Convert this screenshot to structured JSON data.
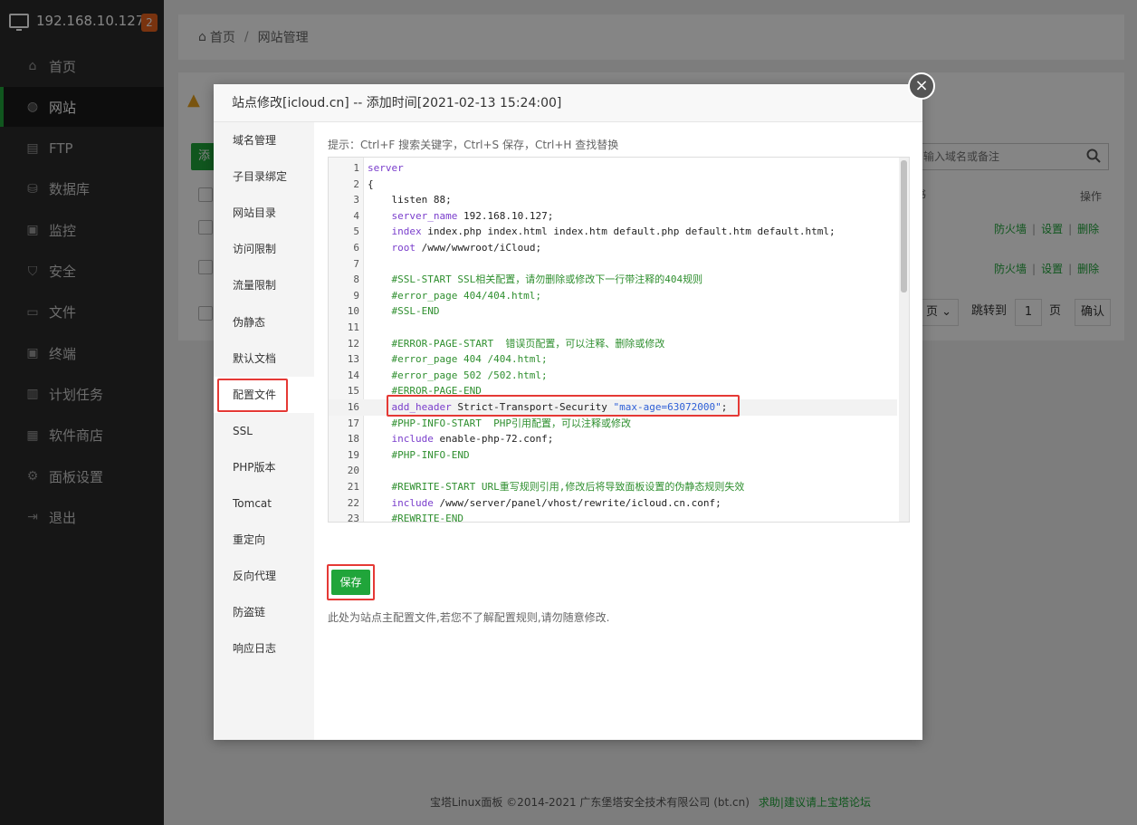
{
  "sidebar": {
    "server_ip": "192.168.10.127",
    "badge": "2",
    "items": [
      {
        "label": "首页",
        "icon": "home-icon"
      },
      {
        "label": "网站",
        "icon": "globe-icon"
      },
      {
        "label": "FTP",
        "icon": "ftp-icon"
      },
      {
        "label": "数据库",
        "icon": "database-icon"
      },
      {
        "label": "监控",
        "icon": "monitor-icon"
      },
      {
        "label": "安全",
        "icon": "shield-icon"
      },
      {
        "label": "文件",
        "icon": "folder-icon"
      },
      {
        "label": "终端",
        "icon": "terminal-icon"
      },
      {
        "label": "计划任务",
        "icon": "clock-icon"
      },
      {
        "label": "软件商店",
        "icon": "grid-icon"
      },
      {
        "label": "面板设置",
        "icon": "gear-icon"
      },
      {
        "label": "退出",
        "icon": "logout-icon"
      }
    ]
  },
  "breadcrumb": {
    "home": "首页",
    "current": "网站管理"
  },
  "background": {
    "add_button": "添",
    "search_placeholder": "输入域名或备注",
    "col_partial": "书",
    "col_ops": "操作",
    "row_ops": {
      "firewall": "防火墙",
      "settings": "设置",
      "delete": "删除"
    },
    "pager": {
      "page_partial": "页",
      "jump_to": "跳转到",
      "page_num": "1",
      "page_unit": "页",
      "confirm": "确认"
    }
  },
  "modal": {
    "title": "站点修改[icloud.cn] -- 添加时间[2021-02-13 15:24:00]",
    "tabs": [
      "域名管理",
      "子目录绑定",
      "网站目录",
      "访问限制",
      "流量限制",
      "伪静态",
      "默认文档",
      "配置文件",
      "SSL",
      "PHP版本",
      "Tomcat",
      "重定向",
      "反向代理",
      "防盗链",
      "响应日志"
    ],
    "active_tab": "配置文件",
    "hint": "提示：Ctrl+F 搜索关键字，Ctrl+S 保存，Ctrl+H 查找替换",
    "save_label": "保存",
    "note": "此处为站点主配置文件,若您不了解配置规则,请勿随意修改.",
    "code_lines": [
      {
        "n": "1",
        "text": "server"
      },
      {
        "n": "2",
        "text": "{"
      },
      {
        "n": "3",
        "text": "    listen 88;"
      },
      {
        "n": "4",
        "text": "    server_name 192.168.10.127;"
      },
      {
        "n": "5",
        "text": "    index index.php index.html index.htm default.php default.htm default.html;"
      },
      {
        "n": "6",
        "text": "    root /www/wwwroot/iCloud;"
      },
      {
        "n": "7",
        "text": ""
      },
      {
        "n": "8",
        "text": "    #SSL-START SSL相关配置，请勿删除或修改下一行带注释的404规则"
      },
      {
        "n": "9",
        "text": "    #error_page 404/404.html;"
      },
      {
        "n": "10",
        "text": "    #SSL-END"
      },
      {
        "n": "11",
        "text": ""
      },
      {
        "n": "12",
        "text": "    #ERROR-PAGE-START  错误页配置，可以注释、删除或修改"
      },
      {
        "n": "13",
        "text": "    #error_page 404 /404.html;"
      },
      {
        "n": "14",
        "text": "    #error_page 502 /502.html;"
      },
      {
        "n": "15",
        "text": "    #ERROR-PAGE-END"
      },
      {
        "n": "16",
        "text": "    add_header Strict-Transport-Security \"max-age=63072000\";"
      },
      {
        "n": "17",
        "text": "    #PHP-INFO-START  PHP引用配置，可以注释或修改"
      },
      {
        "n": "18",
        "text": "    include enable-php-72.conf;"
      },
      {
        "n": "19",
        "text": "    #PHP-INFO-END"
      },
      {
        "n": "20",
        "text": ""
      },
      {
        "n": "21",
        "text": "    #REWRITE-START URL重写规则引用,修改后将导致面板设置的伪静态规则失效"
      },
      {
        "n": "22",
        "text": "    include /www/server/panel/vhost/rewrite/icloud.cn.conf;"
      },
      {
        "n": "23",
        "text": "    #REWRITE-END"
      }
    ]
  },
  "footer": {
    "copyright": "宝塔Linux面板 ©2014-2021 广东堡塔安全技术有限公司 (bt.cn)",
    "link": "求助|建议请上宝塔论坛"
  },
  "colors": {
    "accent": "#20a53a",
    "highlight": "#e53935",
    "badge": "#e8621d"
  }
}
